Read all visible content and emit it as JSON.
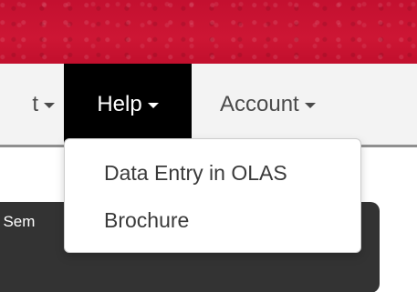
{
  "nav": {
    "prev_item_label": "t",
    "help_label": "Help",
    "account_label": "Account"
  },
  "help_menu": {
    "items": [
      {
        "label": "Data Entry in OLAS"
      },
      {
        "label": "Brochure"
      }
    ]
  },
  "background_panel": {
    "text": "t Sem"
  },
  "colors": {
    "banner": "#c8102e",
    "navbar": "#f3f3f3",
    "active_tab": "#000000",
    "panel": "#333333"
  }
}
